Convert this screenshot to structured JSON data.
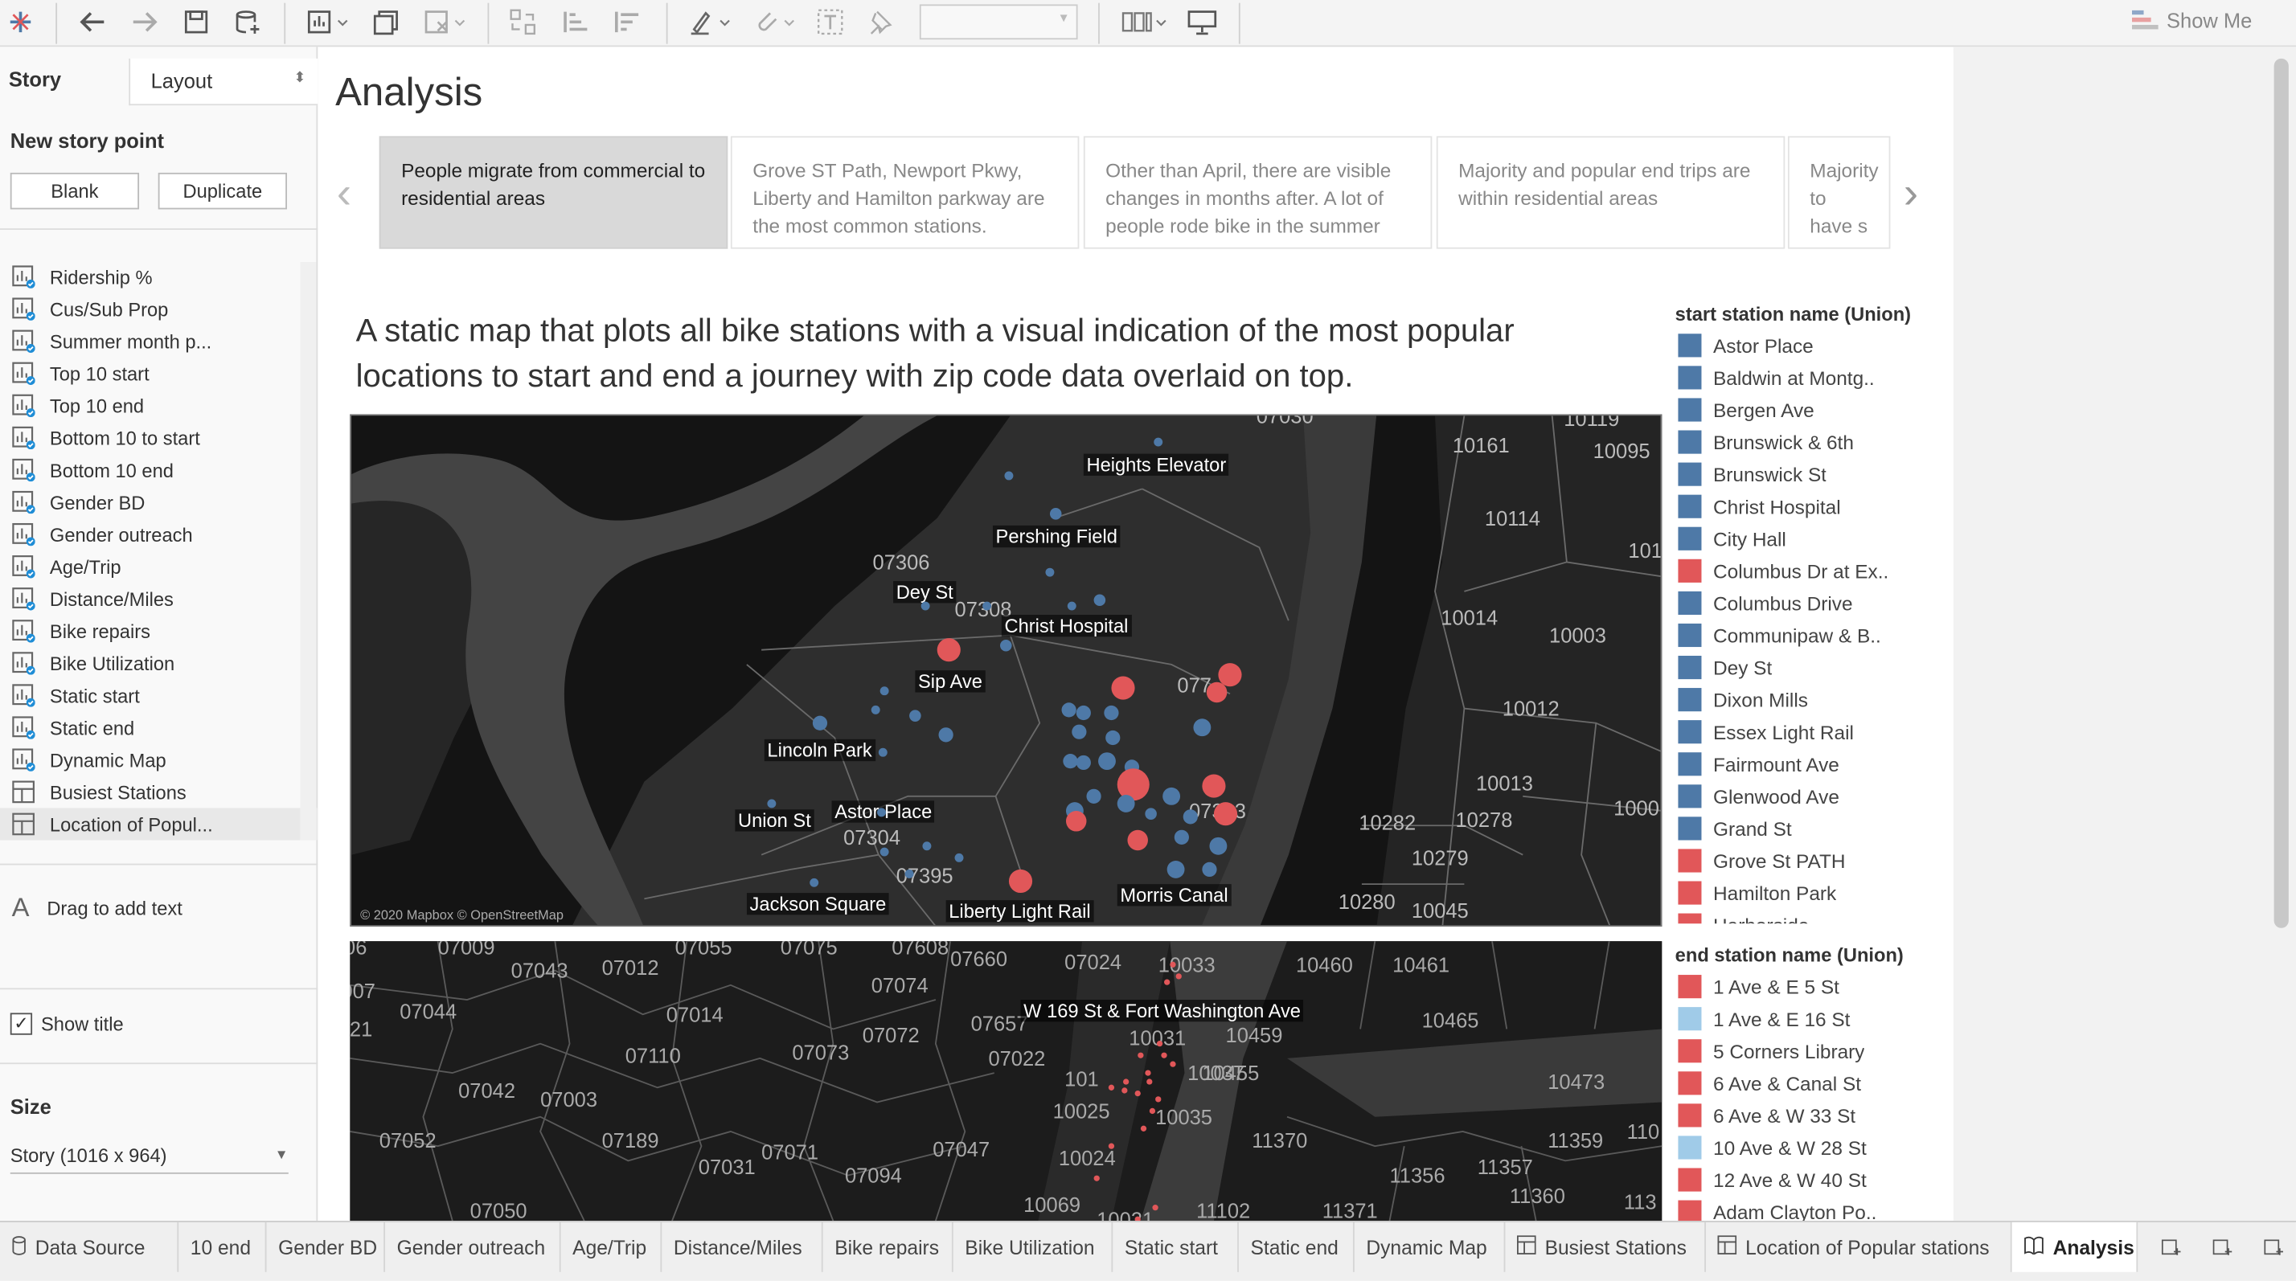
{
  "toolbar": {
    "show_me": "Show Me"
  },
  "sidebar": {
    "tab_story": "Story",
    "tab_layout": "Layout",
    "new_story_point": "New story point",
    "blank_button": "Blank",
    "duplicate_button": "Duplicate",
    "sheets": [
      {
        "label": "Ridership %",
        "kind": "sheet"
      },
      {
        "label": "Cus/Sub Prop",
        "kind": "sheet"
      },
      {
        "label": "Summer month p...",
        "kind": "sheet"
      },
      {
        "label": "Top 10 start",
        "kind": "sheet"
      },
      {
        "label": "Top 10 end",
        "kind": "sheet"
      },
      {
        "label": "Bottom 10 to start",
        "kind": "sheet"
      },
      {
        "label": "Bottom 10 end",
        "kind": "sheet"
      },
      {
        "label": "Gender BD",
        "kind": "sheet"
      },
      {
        "label": "Gender outreach",
        "kind": "sheet"
      },
      {
        "label": "Age/Trip",
        "kind": "sheet"
      },
      {
        "label": "Distance/Miles",
        "kind": "sheet"
      },
      {
        "label": "Bike repairs",
        "kind": "sheet"
      },
      {
        "label": "Bike Utilization",
        "kind": "sheet"
      },
      {
        "label": "Static start",
        "kind": "sheet"
      },
      {
        "label": "Static end",
        "kind": "sheet"
      },
      {
        "label": "Dynamic Map",
        "kind": "sheet"
      },
      {
        "label": "Busiest Stations",
        "kind": "dashboard"
      },
      {
        "label": "Location of Popul...",
        "kind": "dashboard"
      }
    ],
    "drag_text": "Drag to add text",
    "show_title": "Show title",
    "size_label": "Size",
    "size_value": "Story (1016 x 964)"
  },
  "story": {
    "title": "Analysis",
    "points": [
      "People migrate from commercial to residential areas",
      "Grove ST Path, Newport Pkwy, Liberty and Hamilton parkway are the most common stations.",
      "Other than April, there are visible changes in months after. A lot of people rode bike in the summer",
      "Majority and popular end trips are within residential areas",
      "Majority to have s areas"
    ],
    "caption": "A static map that plots all bike stations with a visual indication of the most popular locations to start and end a journey with zip code data overlaid on top."
  },
  "map1": {
    "station_labels": [
      "Heights Elevator",
      "Pershing Field",
      "Dey St",
      "Christ Hospital",
      "Sip Ave",
      "Lincoln Park",
      "Astor Place",
      "Union St",
      "Jackson Square",
      "Liberty Light Rail",
      "Morris Canal"
    ],
    "zip_labels": [
      "07030",
      "07306",
      "07308",
      "07304",
      "07395",
      "07303",
      "077",
      "10161",
      "10095",
      "10119",
      "10114",
      "10014",
      "10003",
      "10012",
      "10013",
      "10282",
      "10278",
      "10279",
      "10280",
      "10045",
      "1000",
      "101",
      "07",
      "0"
    ],
    "attribution": "© 2020 Mapbox © OpenStreetMap"
  },
  "map2": {
    "station_labels": [
      "W 169 St & Fort Washington Ave"
    ],
    "zip_labels": [
      "06",
      "07009",
      "07055",
      "07075",
      "07608",
      "07660",
      "07024",
      "10033",
      "10460",
      "10461",
      "007",
      "07043",
      "07012",
      "07074",
      "07044",
      "07014",
      "07657",
      "10031",
      "10459",
      "10465",
      "021",
      "07110",
      "07073",
      "07072",
      "07022",
      "10037",
      "10455",
      "10473",
      "07042",
      "07003",
      "101",
      "10025",
      "10035",
      "07052",
      "07189",
      "07071",
      "07047",
      "10024",
      "11370",
      "11359",
      "110",
      "07031",
      "07094",
      "11356",
      "11357",
      "07050",
      "10069",
      "10021",
      "11102",
      "11371",
      "11360",
      "113"
    ]
  },
  "legend_start": {
    "title": "start station name (Union)",
    "items": [
      {
        "label": "Astor Place",
        "color": "#4e79a7"
      },
      {
        "label": "Baldwin at Montg..",
        "color": "#4e79a7"
      },
      {
        "label": "Bergen Ave",
        "color": "#4e79a7"
      },
      {
        "label": "Brunswick & 6th",
        "color": "#4e79a7"
      },
      {
        "label": "Brunswick St",
        "color": "#4e79a7"
      },
      {
        "label": "Christ Hospital",
        "color": "#4e79a7"
      },
      {
        "label": "City Hall",
        "color": "#4e79a7"
      },
      {
        "label": "Columbus Dr at Ex..",
        "color": "#e15759"
      },
      {
        "label": "Columbus Drive",
        "color": "#4e79a7"
      },
      {
        "label": "Communipaw & B..",
        "color": "#4e79a7"
      },
      {
        "label": "Dey St",
        "color": "#4e79a7"
      },
      {
        "label": "Dixon Mills",
        "color": "#4e79a7"
      },
      {
        "label": "Essex Light Rail",
        "color": "#4e79a7"
      },
      {
        "label": "Fairmount Ave",
        "color": "#4e79a7"
      },
      {
        "label": "Glenwood Ave",
        "color": "#4e79a7"
      },
      {
        "label": "Grand St",
        "color": "#4e79a7"
      },
      {
        "label": "Grove St PATH",
        "color": "#e15759"
      },
      {
        "label": "Hamilton Park",
        "color": "#e15759"
      },
      {
        "label": "Harborside",
        "color": "#e15759"
      }
    ]
  },
  "legend_end": {
    "title": "end station name (Union)",
    "items": [
      {
        "label": "1 Ave & E 5 St",
        "color": "#e15759"
      },
      {
        "label": "1 Ave & E 16 St",
        "color": "#a0cbe8"
      },
      {
        "label": "5 Corners Library",
        "color": "#e15759"
      },
      {
        "label": "6 Ave & Canal St",
        "color": "#e15759"
      },
      {
        "label": "6 Ave & W 33 St",
        "color": "#e15759"
      },
      {
        "label": "10 Ave & W 28 St",
        "color": "#a0cbe8"
      },
      {
        "label": "12 Ave & W 40 St",
        "color": "#e15759"
      },
      {
        "label": "Adam Clayton Po..",
        "color": "#e15759"
      }
    ]
  },
  "bottom_tabs": [
    {
      "label": "Data Source",
      "kind": "source"
    },
    {
      "label": "10 end",
      "kind": "sheet"
    },
    {
      "label": "Gender BD",
      "kind": "sheet"
    },
    {
      "label": "Gender outreach",
      "kind": "sheet"
    },
    {
      "label": "Age/Trip",
      "kind": "sheet"
    },
    {
      "label": "Distance/Miles",
      "kind": "sheet"
    },
    {
      "label": "Bike repairs",
      "kind": "sheet"
    },
    {
      "label": "Bike Utilization",
      "kind": "sheet"
    },
    {
      "label": "Static start",
      "kind": "sheet"
    },
    {
      "label": "Static end",
      "kind": "sheet"
    },
    {
      "label": "Dynamic Map",
      "kind": "sheet"
    },
    {
      "label": "Busiest Stations",
      "kind": "dashboard"
    },
    {
      "label": "Location of Popular stations",
      "kind": "dashboard"
    },
    {
      "label": "Analysis",
      "kind": "story"
    }
  ],
  "colors": {
    "start_blue": "#4e79a7",
    "end_red": "#e15759",
    "light_blue": "#a0cbe8",
    "map_bg": "#151515"
  }
}
